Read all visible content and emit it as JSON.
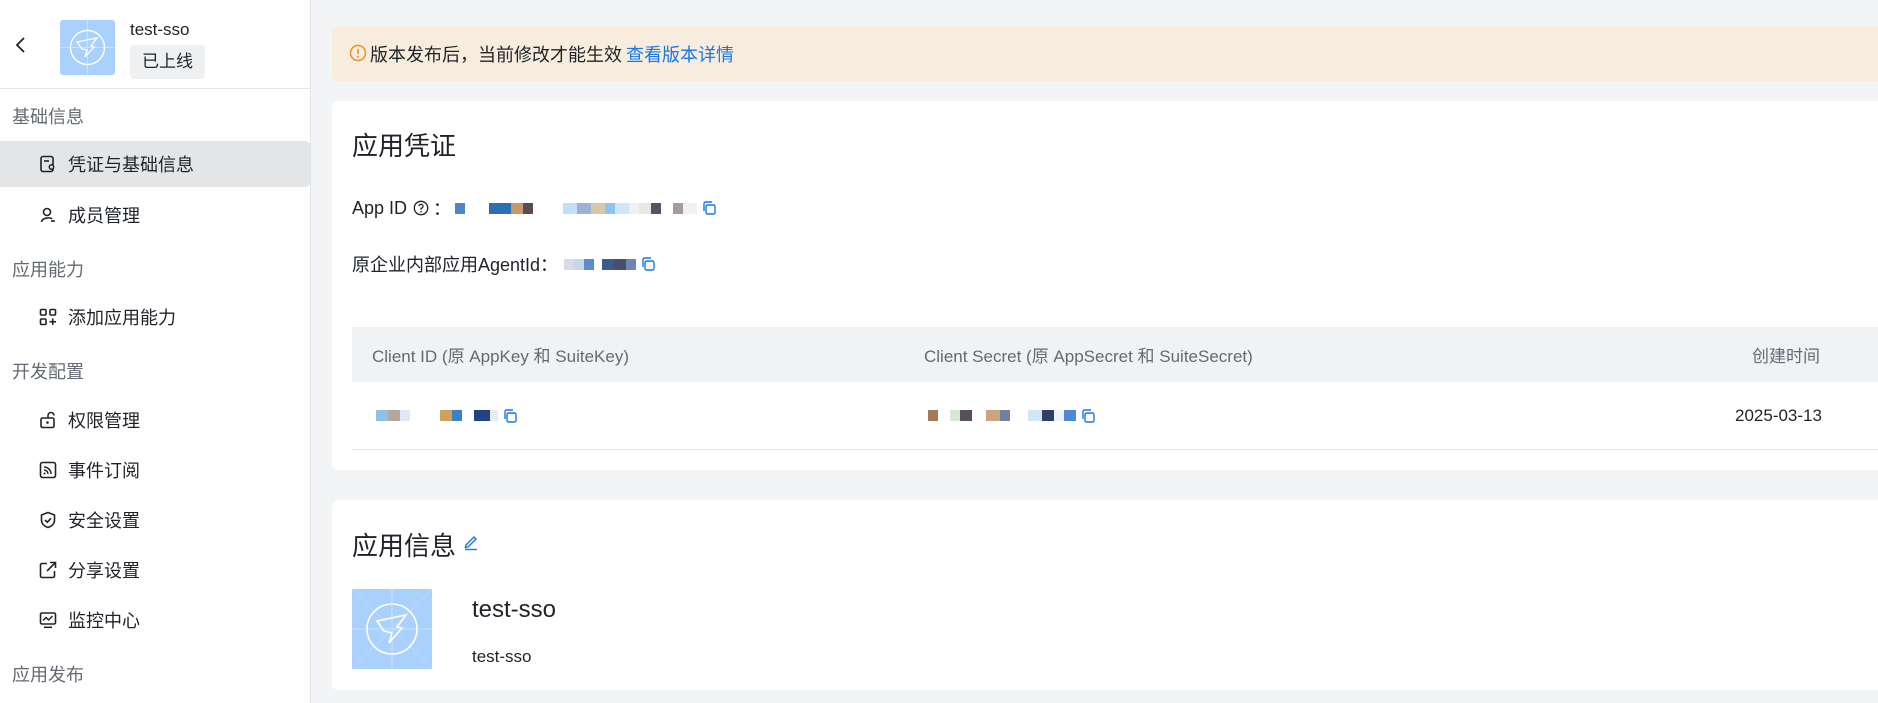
{
  "app": {
    "name": "test-sso",
    "status": "已上线"
  },
  "sidebar": {
    "sections": [
      {
        "title": "基础信息",
        "items": [
          {
            "label": "凭证与基础信息",
            "icon": "credential-icon",
            "active": true
          },
          {
            "label": "成员管理",
            "icon": "person-icon",
            "active": false
          }
        ]
      },
      {
        "title": "应用能力",
        "items": [
          {
            "label": "添加应用能力",
            "icon": "apps-add-icon",
            "active": false
          }
        ]
      },
      {
        "title": "开发配置",
        "items": [
          {
            "label": "权限管理",
            "icon": "lock-icon",
            "active": false
          },
          {
            "label": "事件订阅",
            "icon": "rss-icon",
            "active": false
          },
          {
            "label": "安全设置",
            "icon": "shield-icon",
            "active": false
          },
          {
            "label": "分享设置",
            "icon": "share-icon",
            "active": false
          },
          {
            "label": "监控中心",
            "icon": "monitor-icon",
            "active": false
          }
        ]
      },
      {
        "title": "应用发布",
        "items": []
      }
    ]
  },
  "notice": {
    "text": "版本发布后，当前修改才能生效",
    "link": "查看版本详情"
  },
  "credentials": {
    "title": "应用凭证",
    "app_id_label": "App ID",
    "app_id_colon": "：",
    "agent_id_label": "原企业内部应用AgentId：",
    "table": {
      "headers": [
        "Client ID (原 AppKey 和 SuiteKey)",
        "Client Secret (原 AppSecret 和 SuiteSecret)",
        "创建时间"
      ],
      "rows": [
        {
          "created": "2025-03-13"
        }
      ]
    }
  },
  "app_info": {
    "title": "应用信息",
    "name": "test-sso",
    "description": "test-sso"
  },
  "colors": {
    "accent": "#1677e6",
    "notice_bg": "#f7ecde",
    "warn": "#e79425",
    "logo_bg": "#a9d1fb"
  }
}
